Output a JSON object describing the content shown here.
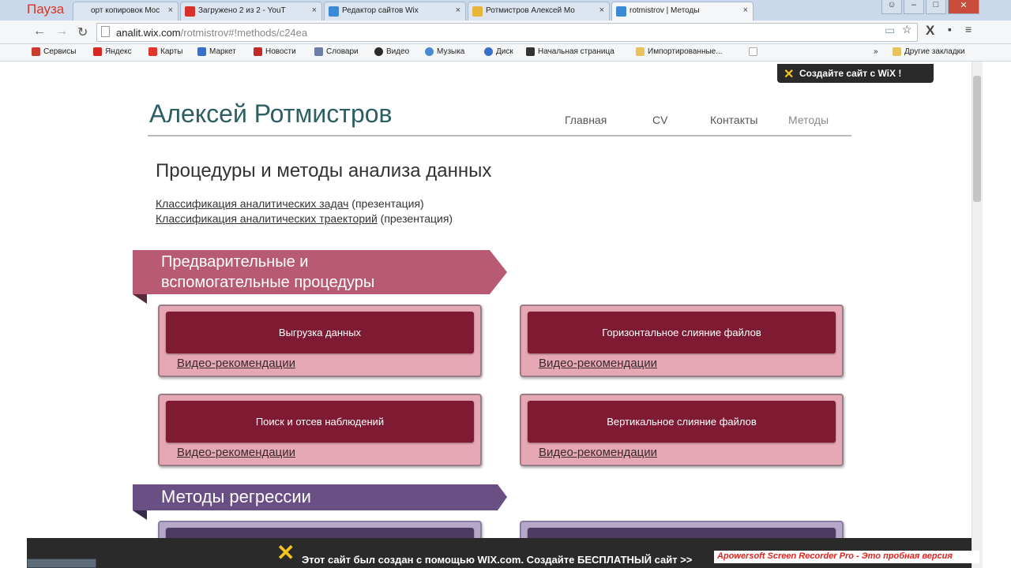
{
  "overlay": {
    "pause_label": "Пауза",
    "recorder_watermark": "Apowersoft Screen Recorder Pro - Это пробная версия"
  },
  "browser": {
    "tabs": [
      {
        "title": "орт копировок Moc",
        "icon_color": "#4a7fd0"
      },
      {
        "title": "Загружено 2 из 2 - YouT",
        "icon_color": "#d9302a"
      },
      {
        "title": "Редактор сайтов Wix",
        "icon_color": "#3b8ad8"
      },
      {
        "title": "Ротмистров Алексей Mo",
        "icon_color": "#e8b53a"
      },
      {
        "title": "rotmistrov | Методы",
        "icon_color": "#3b8ad8"
      }
    ],
    "close_glyph": "×",
    "url_domain": "analit.wix.com",
    "url_path": "/rotmistrov#!methods/c24ea",
    "bookmarks": [
      {
        "label": "Сервисы",
        "icon_color": "#c93c2f"
      },
      {
        "label": "Яндекс",
        "icon_color": "#d8281f"
      },
      {
        "label": "Карты",
        "icon_color": "#e3362a"
      },
      {
        "label": "Маркет",
        "icon_color": "#3a6fc9"
      },
      {
        "label": "Новости",
        "icon_color": "#c22a26"
      },
      {
        "label": "Словари",
        "icon_color": "#6a7ea8"
      },
      {
        "label": "Видео",
        "icon_color": "#2b2b2b"
      },
      {
        "label": "Музыка",
        "icon_color": "#4a8ad0"
      },
      {
        "label": "Диск",
        "icon_color": "#3a6fc9"
      },
      {
        "label": "Начальная страница",
        "icon_color": "#333333"
      },
      {
        "label": "Импортированные...",
        "icon_color": "#e8c25a"
      }
    ],
    "other_bookmarks": "Другие закладки"
  },
  "site": {
    "wix_badge": "Создайте сайт с WiX !",
    "title": "Алексей Ротмистров",
    "nav": [
      "Главная",
      "CV",
      "Контакты",
      "Методы"
    ],
    "page_heading": "Процедуры и методы анализа данных",
    "links": [
      {
        "text": "Классификация аналитических задач",
        "suffix": "(презентация)"
      },
      {
        "text": "Классификация аналитических траекторий",
        "suffix": "(презентация)"
      }
    ],
    "sections": [
      {
        "title_line1": "Предварительные и",
        "title_line2": "вспомогательные процедуры",
        "color": "#b85a72",
        "cards": [
          {
            "label": "Выгрузка данных",
            "link": "Видео-рекомендации"
          },
          {
            "label": "Горизонтальное слияние файлов",
            "link": "Видео-рекомендации"
          },
          {
            "label": "Поиск и отсев наблюдений",
            "link": "Видео-рекомендации"
          },
          {
            "label": "Вертикальное слияние файлов",
            "link": "Видео-рекомендации"
          }
        ]
      },
      {
        "title_line1": "Методы регрессии",
        "color": "#6a4f85"
      }
    ]
  },
  "ad_bar": {
    "text": "Этот сайт был создан с помощью WIX.com. Создайте БЕСПЛАТНЫЙ сайт >>"
  }
}
